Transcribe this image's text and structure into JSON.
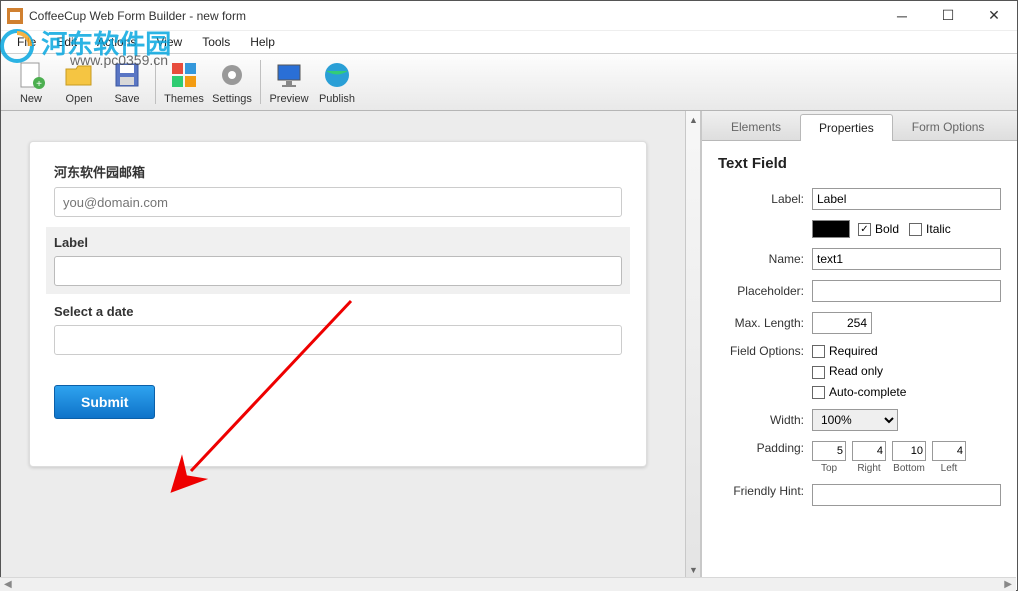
{
  "window": {
    "title": "CoffeeCup Web Form Builder - new form"
  },
  "watermark": {
    "main": "河东软件园",
    "sub": "www.pc0359.cn"
  },
  "menu": {
    "file": "File",
    "edit": "Edit",
    "actions": "Actions",
    "view": "View",
    "tools": "Tools",
    "help": "Help"
  },
  "toolbar": {
    "new": "New",
    "open": "Open",
    "save": "Save",
    "themes": "Themes",
    "settings": "Settings",
    "preview": "Preview",
    "publish": "Publish"
  },
  "form": {
    "field1_label": "河东软件园邮箱",
    "field1_placeholder": "you@domain.com",
    "field2_label": "Label",
    "field3_label": "Select a date",
    "submit": "Submit"
  },
  "panel": {
    "tabs": {
      "elements": "Elements",
      "properties": "Properties",
      "form_options": "Form Options"
    },
    "section": "Text Field",
    "label_lbl": "Label:",
    "label_val": "Label",
    "bold": "Bold",
    "italic": "Italic",
    "name_lbl": "Name:",
    "name_val": "text1",
    "placeholder_lbl": "Placeholder:",
    "placeholder_val": "",
    "maxlen_lbl": "Max. Length:",
    "maxlen_val": "254",
    "fieldopt_lbl": "Field Options:",
    "opt_required": "Required",
    "opt_readonly": "Read only",
    "opt_autocomplete": "Auto-complete",
    "width_lbl": "Width:",
    "width_val": "100%",
    "padding_lbl": "Padding:",
    "pad": {
      "top": "5",
      "right": "4",
      "bottom": "10",
      "left": "4",
      "top_lbl": "Top",
      "right_lbl": "Right",
      "bottom_lbl": "Bottom",
      "left_lbl": "Left"
    },
    "hint_lbl": "Friendly Hint:",
    "hint_val": ""
  }
}
